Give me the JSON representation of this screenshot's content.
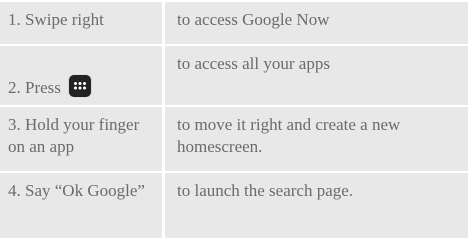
{
  "steps": [
    {
      "step": "1. Swipe right",
      "action": "to access Google Now"
    },
    {
      "step": "2. Press",
      "icon": "app-drawer-icon",
      "action": "to access all your apps"
    },
    {
      "step": "3. Hold your finger on an app",
      "action": "to move it right and create a new homescreen."
    },
    {
      "step": "4. Say “Ok Google”",
      "action": "to launch the search page."
    }
  ]
}
